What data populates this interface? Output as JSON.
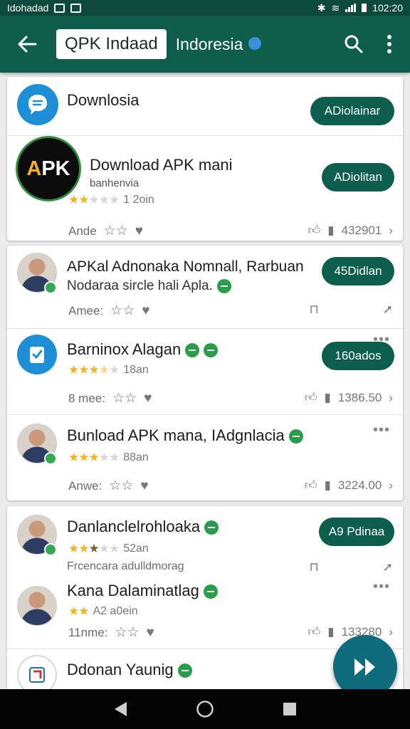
{
  "status_bar": {
    "carrier": "Idohadad",
    "time": "102:20"
  },
  "app_bar": {
    "title": "QPK Indaad",
    "subtitle": "Indoresia"
  },
  "colors": {
    "primary": "#0f5d4b",
    "status_bar": "#0d4a3c",
    "button": "#0d5e4c",
    "star": "#f2b321",
    "verified_green": "#2a9d4a",
    "fab": "#0e6c7c"
  },
  "cards": [
    {
      "rows": [
        {
          "icon": "chat-bubble-icon",
          "title": "Downlosia",
          "button": "ADiolainar"
        },
        {
          "icon": "apk-logo",
          "logo_text": "APK",
          "title": "Download APK mani",
          "subtitle": "banhenvia",
          "rating": 2,
          "rating_count": "1 2oin",
          "meta": "Ande",
          "count": "432901",
          "button": "ADiolitan"
        }
      ]
    },
    {
      "rows": [
        {
          "icon": "person-avatar",
          "title": "APKal Adnonaka Nomnall, Rarbuan",
          "subtitle": "Nodaraa sircle hali Apla.",
          "meta": "Amee:",
          "button": "45Didlan"
        },
        {
          "icon": "clipboard-icon",
          "title": "Barninox Alagan",
          "rating": 3.5,
          "rating_count": "18an",
          "meta": "8 mee:",
          "count": "1386.50",
          "button": "160ados"
        },
        {
          "icon": "person-avatar",
          "title": "Bunload APK mana, IAdgnlacia",
          "rating": 3,
          "rating_count": "88an",
          "meta": "Anwe:",
          "count": "3224.00"
        }
      ]
    },
    {
      "rows": [
        {
          "icon": "person-avatar",
          "title": "Danlanclelrohloaka",
          "rating": 2.5,
          "rating_count": "52an",
          "meta": "Frcencara adulldmorag",
          "button": "A9 Pdinaa"
        },
        {
          "icon": "person-avatar",
          "title": "Kana Dalaminatlag",
          "rating": 2,
          "rating_count": "A2 a0ein",
          "meta": "11nme:",
          "count": "133280"
        },
        {
          "icon": "tile-icon",
          "title": "Ddonan Yaunig"
        }
      ]
    }
  ]
}
